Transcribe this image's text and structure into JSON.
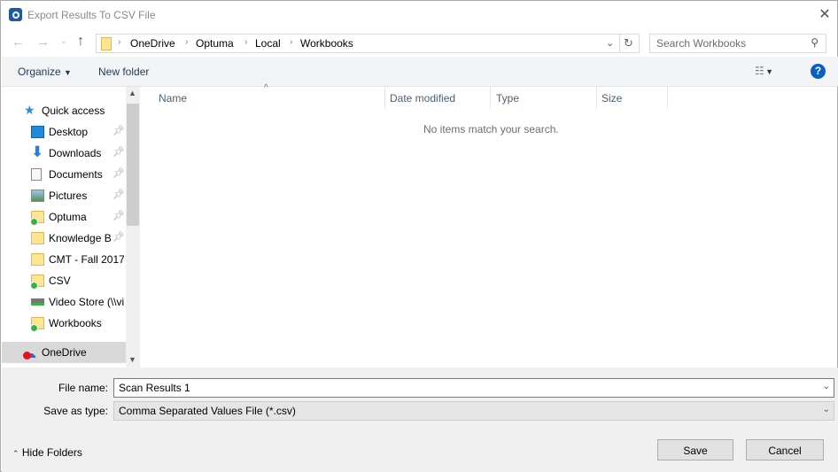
{
  "window": {
    "title": "Export Results To CSV File",
    "close_icon": "close-icon"
  },
  "address": {
    "crumbs": [
      "OneDrive",
      "Optuma",
      "Local",
      "Workbooks"
    ]
  },
  "search": {
    "placeholder": "Search Workbooks"
  },
  "toolbar": {
    "organize": "Organize",
    "new_folder": "New folder",
    "help": "?"
  },
  "nav": {
    "quick_access": "Quick access",
    "items": [
      {
        "label": "Desktop",
        "icon": "desktop-icon",
        "pinned": true
      },
      {
        "label": "Downloads",
        "icon": "download-icon",
        "pinned": true
      },
      {
        "label": "Documents",
        "icon": "document-icon",
        "pinned": true
      },
      {
        "label": "Pictures",
        "icon": "pictures-icon",
        "pinned": true
      },
      {
        "label": "Optuma",
        "icon": "folder-synced-icon",
        "pinned": true
      },
      {
        "label": "Knowledge B",
        "icon": "folder-icon",
        "pinned": true
      },
      {
        "label": "CMT - Fall 2017",
        "icon": "folder-icon",
        "pinned": false
      },
      {
        "label": "CSV",
        "icon": "folder-synced-icon",
        "pinned": false
      },
      {
        "label": "Video Store (\\\\vi",
        "icon": "network-drive-icon",
        "pinned": false
      },
      {
        "label": "Workbooks",
        "icon": "folder-synced-icon",
        "pinned": false
      }
    ],
    "onedrive": "OneDrive"
  },
  "columns": [
    "Name",
    "Date modified",
    "Type",
    "Size"
  ],
  "empty_message": "No items match your search.",
  "form": {
    "file_name_label": "File name:",
    "file_name": "Scan Results 1",
    "type_label": "Save as type:",
    "type_value": "Comma Separated Values File (*.csv)"
  },
  "buttons": {
    "hide_folders": "Hide Folders",
    "save": "Save",
    "cancel": "Cancel"
  }
}
